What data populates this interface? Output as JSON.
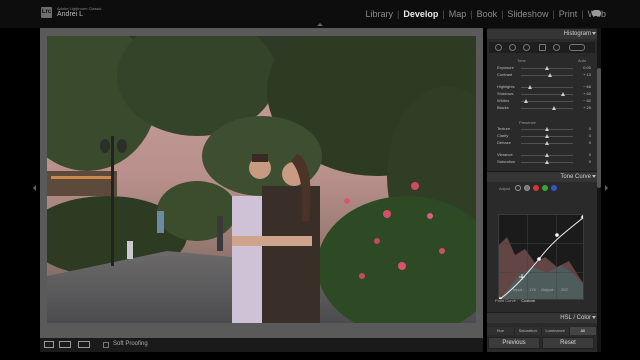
{
  "header": {
    "logo": "Lrc",
    "app_name": "Adobe Lightroom Classic",
    "user": "Andrei L"
  },
  "modules": [
    "Library",
    "Develop",
    "Map",
    "Book",
    "Slideshow",
    "Print",
    "Web"
  ],
  "active_module": "Develop",
  "toolbar": {
    "soft_proofing_label": "Soft Proofing",
    "soft_proofing_checked": false
  },
  "panel": {
    "histogram_title": "Histogram",
    "tone_label": "Tone",
    "auto_label": "Auto",
    "sliders_tone": [
      {
        "label": "Exposure",
        "value": "0.00",
        "pos": 0.5
      },
      {
        "label": "Contrast",
        "value": "+ 13",
        "pos": 0.56
      }
    ],
    "sliders_tone2": [
      {
        "label": "Highlights",
        "value": "− 66",
        "pos": 0.17
      },
      {
        "label": "Shadows",
        "value": "+ 60",
        "pos": 0.8
      },
      {
        "label": "Whites",
        "value": "− 82",
        "pos": 0.1
      },
      {
        "label": "Blacks",
        "value": "+ 26",
        "pos": 0.63
      }
    ],
    "presence_label": "Presence",
    "sliders_presence": [
      {
        "label": "Texture",
        "value": "0",
        "pos": 0.5
      },
      {
        "label": "Clarity",
        "value": "0",
        "pos": 0.5
      },
      {
        "label": "Dehaze",
        "value": "0",
        "pos": 0.5
      }
    ],
    "sliders_presence2": [
      {
        "label": "Vibrance",
        "value": "0",
        "pos": 0.5
      },
      {
        "label": "Saturation",
        "value": "0",
        "pos": 0.5
      }
    ],
    "tone_curve_title": "Tone Curve",
    "adjust_label": "Adjust",
    "input_label": "Input :",
    "input_value": "178",
    "output_label": "Output :",
    "output_value": "202",
    "point_curve_label": "Point Curve :",
    "point_curve_value": "Custom",
    "hsl_title": "HSL / Color",
    "hsl_tabs": [
      "Hue",
      "Saturation",
      "Luminance",
      "All"
    ],
    "hsl_selected": "All"
  },
  "buttons": {
    "previous": "Previous",
    "reset": "Reset"
  },
  "colors": {
    "accent_active": "#e8e8e8",
    "panel_bg": "#2a2a2a",
    "canvas_bg": "#5a5a5a"
  }
}
